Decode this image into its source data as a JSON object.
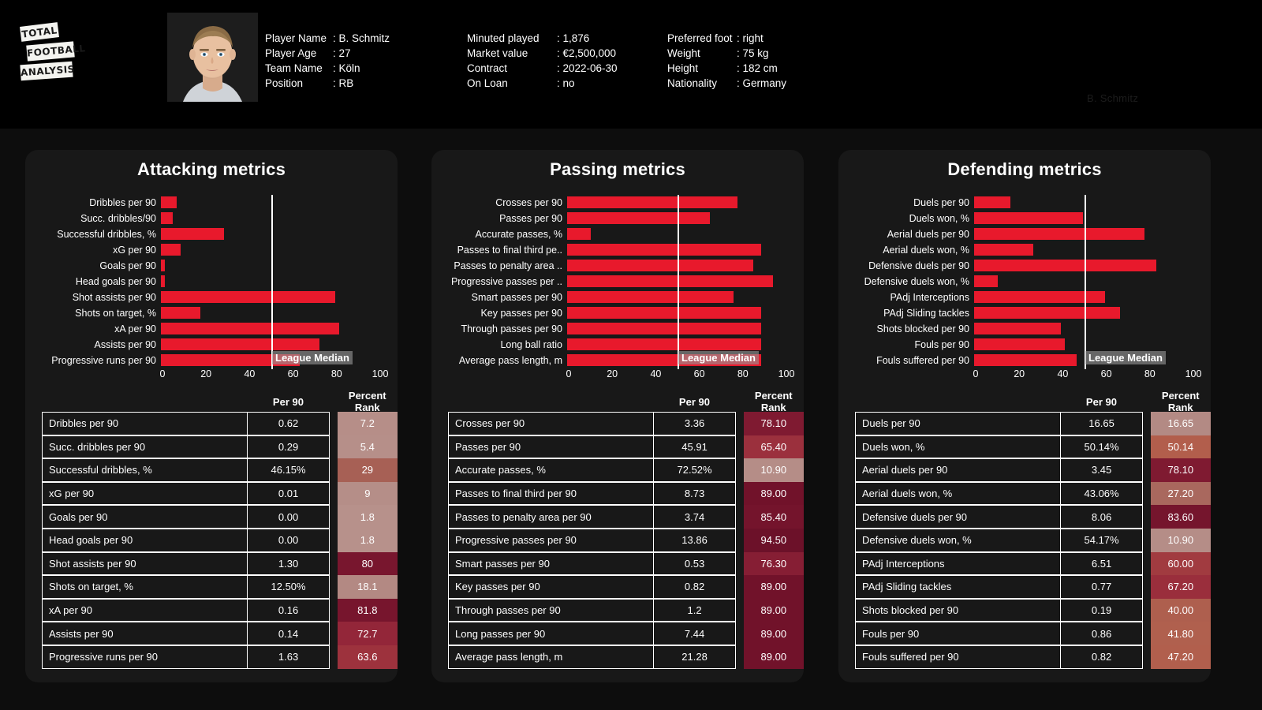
{
  "logo": {
    "line1": "TOTAL",
    "line2": "FOOTBALL",
    "line3": "ANALYSIS"
  },
  "watermark": "B. Schmitz",
  "player_info": {
    "column_1": [
      {
        "label": "Player Name",
        "value": ": B. Schmitz"
      },
      {
        "label": "Player Age",
        "value": ": 27"
      },
      {
        "label": "Team Name",
        "value": ": Köln"
      },
      {
        "label": "Position",
        "value": ": RB"
      }
    ],
    "column_2": [
      {
        "label": "Minuted played",
        "value": ": 1,876"
      },
      {
        "label": "Market value",
        "value": ": €2,500,000"
      },
      {
        "label": "Contract",
        "value": ": 2022-06-30"
      },
      {
        "label": "On Loan",
        "value": ": no"
      }
    ],
    "column_3": [
      {
        "label": "Preferred foot",
        "value": ": right"
      },
      {
        "label": "Weight",
        "value": ": 75 kg"
      },
      {
        "label": "Height",
        "value": ": 182 cm"
      },
      {
        "label": "Nationality",
        "value": ": Germany"
      }
    ]
  },
  "table_headers": {
    "metric": "",
    "per90": "Per 90",
    "rank": "Percent Rank"
  },
  "median_label": "League Median",
  "axis_ticks": [
    "0",
    "20",
    "40",
    "60",
    "80",
    "100"
  ],
  "chart_data": [
    {
      "type": "bar",
      "title": "Attacking metrics",
      "xlabel": "",
      "ylabel": "",
      "xlim": [
        0,
        100
      ],
      "grid": false,
      "orientation": "horizontal",
      "legend": "League Median",
      "median_value": 50,
      "categories": [
        "Dribbles per 90",
        "Succ. dribbles/90",
        "Successful dribbles, %",
        "xG per 90",
        "Goals per 90",
        "Head goals per 90",
        "Shot assists per 90",
        "Shots on target, %",
        "xA per 90",
        "Assists per 90",
        "Progressive runs per 90"
      ],
      "values": [
        7.2,
        5.4,
        29,
        9,
        1.8,
        1.8,
        80,
        18.1,
        81.8,
        72.7,
        63.6
      ],
      "rows": [
        {
          "metric": "Dribbles per 90",
          "per90": "0.62",
          "rank": "7.2",
          "rank_value": 7.2
        },
        {
          "metric": "Succ. dribbles per 90",
          "per90": "0.29",
          "rank": "5.4",
          "rank_value": 5.4
        },
        {
          "metric": "Successful dribbles, %",
          "per90": "46.15%",
          "rank": "29",
          "rank_value": 29
        },
        {
          "metric": "xG per 90",
          "per90": "0.01",
          "rank": "9",
          "rank_value": 9
        },
        {
          "metric": "Goals per 90",
          "per90": "0.00",
          "rank": "1.8",
          "rank_value": 1.8
        },
        {
          "metric": "Head goals per 90",
          "per90": "0.00",
          "rank": "1.8",
          "rank_value": 1.8
        },
        {
          "metric": "Shot assists per 90",
          "per90": "1.30",
          "rank": "80",
          "rank_value": 80
        },
        {
          "metric": "Shots on target, %",
          "per90": "12.50%",
          "rank": "18.1",
          "rank_value": 18.1
        },
        {
          "metric": "xA per 90",
          "per90": "0.16",
          "rank": "81.8",
          "rank_value": 81.8
        },
        {
          "metric": "Assists per 90",
          "per90": "0.14",
          "rank": "72.7",
          "rank_value": 72.7
        },
        {
          "metric": "Progressive runs per 90",
          "per90": "1.63",
          "rank": "63.6",
          "rank_value": 63.6
        }
      ]
    },
    {
      "type": "bar",
      "title": "Passing metrics",
      "xlabel": "",
      "ylabel": "",
      "xlim": [
        0,
        100
      ],
      "grid": false,
      "orientation": "horizontal",
      "legend": "League Median",
      "median_value": 50,
      "categories": [
        "Crosses per 90",
        "Passes per 90",
        "Accurate passes, %",
        "Passes to final third pe..",
        "Passes to penalty area ..",
        "Progressive passes per ..",
        "Smart passes per 90",
        "Key passes per 90",
        "Through passes per 90",
        "Long ball ratio",
        "Average pass length, m"
      ],
      "values": [
        78.1,
        65.4,
        10.9,
        89.0,
        85.4,
        94.5,
        76.3,
        89.0,
        89.0,
        89.0,
        89.0
      ],
      "rows": [
        {
          "metric": "Crosses per 90",
          "per90": "3.36",
          "rank": "78.10",
          "rank_value": 78.1
        },
        {
          "metric": "Passes per 90",
          "per90": "45.91",
          "rank": "65.40",
          "rank_value": 65.4
        },
        {
          "metric": "Accurate passes, %",
          "per90": "72.52%",
          "rank": "10.90",
          "rank_value": 10.9
        },
        {
          "metric": "Passes to final third per 90",
          "per90": "8.73",
          "rank": "89.00",
          "rank_value": 89.0
        },
        {
          "metric": "Passes to penalty area per 90",
          "per90": "3.74",
          "rank": "85.40",
          "rank_value": 85.4
        },
        {
          "metric": "Progressive passes per 90",
          "per90": "13.86",
          "rank": "94.50",
          "rank_value": 94.5
        },
        {
          "metric": "Smart passes per 90",
          "per90": "0.53",
          "rank": "76.30",
          "rank_value": 76.3
        },
        {
          "metric": "Key passes per 90",
          "per90": "0.82",
          "rank": "89.00",
          "rank_value": 89.0
        },
        {
          "metric": "Through passes per 90",
          "per90": "1.2",
          "rank": "89.00",
          "rank_value": 89.0
        },
        {
          "metric": "Long passes per 90",
          "per90": "7.44",
          "rank": "89.00",
          "rank_value": 89.0
        },
        {
          "metric": "Average pass length, m",
          "per90": "21.28",
          "rank": "89.00",
          "rank_value": 89.0
        }
      ]
    },
    {
      "type": "bar",
      "title": "Defending metrics",
      "xlabel": "",
      "ylabel": "",
      "xlim": [
        0,
        100
      ],
      "grid": false,
      "orientation": "horizontal",
      "legend": "League Median",
      "median_value": 50,
      "categories": [
        "Duels per 90",
        "Duels won, %",
        "Aerial duels per 90",
        "Aerial duels won, %",
        "Defensive duels per 90",
        "Defensive duels won, %",
        "PAdj Interceptions",
        "PAdj Sliding tackles",
        "Shots blocked per 90",
        "Fouls per 90",
        "Fouls suffered per 90"
      ],
      "values": [
        16.65,
        50.14,
        78.1,
        27.2,
        83.6,
        10.9,
        60.0,
        67.2,
        40.0,
        41.8,
        47.2
      ],
      "rows": [
        {
          "metric": "Duels per 90",
          "per90": "16.65",
          "rank": "16.65",
          "rank_value": 16.65
        },
        {
          "metric": "Duels won, %",
          "per90": "50.14%",
          "rank": "50.14",
          "rank_value": 50.14
        },
        {
          "metric": "Aerial duels per 90",
          "per90": "3.45",
          "rank": "78.10",
          "rank_value": 78.1
        },
        {
          "metric": "Aerial duels won, %",
          "per90": "43.06%",
          "rank": "27.20",
          "rank_value": 27.2
        },
        {
          "metric": "Defensive duels per 90",
          "per90": "8.06",
          "rank": "83.60",
          "rank_value": 83.6
        },
        {
          "metric": "Defensive duels won, %",
          "per90": "54.17%",
          "rank": "10.90",
          "rank_value": 10.9
        },
        {
          "metric": "PAdj Interceptions",
          "per90": "6.51",
          "rank": "60.00",
          "rank_value": 60.0
        },
        {
          "metric": "PAdj Sliding tackles",
          "per90": "0.77",
          "rank": "67.20",
          "rank_value": 67.2
        },
        {
          "metric": "Shots blocked per 90",
          "per90": "0.19",
          "rank": "40.00",
          "rank_value": 40.0
        },
        {
          "metric": "Fouls per 90",
          "per90": "0.86",
          "rank": "41.80",
          "rank_value": 41.8
        },
        {
          "metric": "Fouls suffered per 90",
          "per90": "0.82",
          "rank": "47.20",
          "rank_value": 47.2
        }
      ]
    }
  ],
  "colors": {
    "bar": "#e8192c",
    "panel_bg": "#181818",
    "page_bg": "#0d0d0d",
    "header_bg": "#000000",
    "rank_low": "#b08c87",
    "rank_high": "#6e1228"
  }
}
